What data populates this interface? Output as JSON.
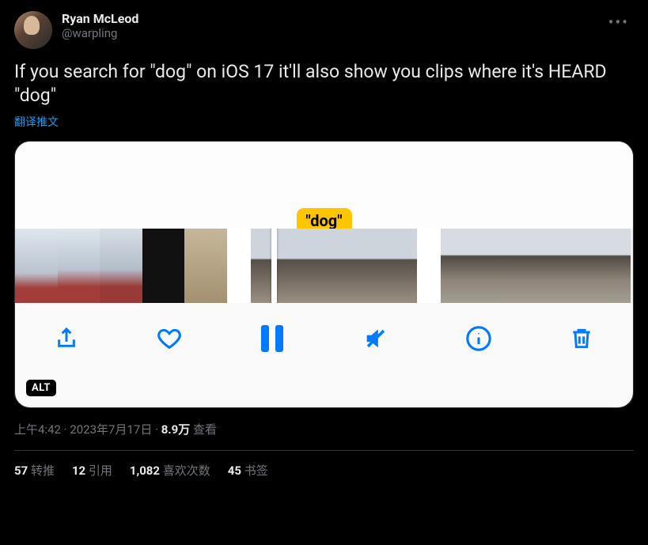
{
  "author": {
    "display_name": "Ryan McLeod",
    "handle": "@warpling"
  },
  "tweet_text": "If you search for \"dog\" on iOS 17 it'll also show you clips where it's HEARD \"dog\"",
  "translate_label": "翻译推文",
  "media": {
    "caption_badge": "\"dog\"",
    "alt_badge": "ALT"
  },
  "meta": {
    "time": "上午4:42",
    "dot1": " · ",
    "date": "2023年7月17日",
    "dot2": " · ",
    "views_count": "8.9万",
    "views_label": " 查看"
  },
  "stats": {
    "retweets_count": "57",
    "retweets_label": " 转推",
    "quotes_count": "12",
    "quotes_label": " 引用",
    "likes_count": "1,082",
    "likes_label": " 喜欢次数",
    "bookmarks_count": "45",
    "bookmarks_label": " 书签"
  }
}
